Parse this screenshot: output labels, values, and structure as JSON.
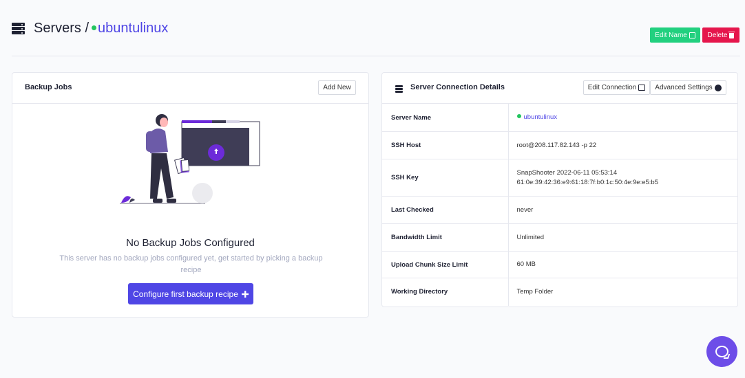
{
  "header": {
    "section": "Servers",
    "separator": "/",
    "server_name": "ubuntulinux",
    "edit_name_label": "Edit Name",
    "delete_label": "Delete"
  },
  "backup_jobs": {
    "title": "Backup Jobs",
    "add_new_label": "Add New",
    "empty_title": "No Backup Jobs Configured",
    "empty_description": "This server has no backup jobs configured yet, get started by picking a backup recipe",
    "cta_label": "Configure first backup recipe"
  },
  "connection": {
    "title": "Server Connection Details",
    "edit_connection_label": "Edit Connection",
    "advanced_settings_label": "Advanced Settings",
    "rows": [
      {
        "key": "Server Name",
        "value": "ubuntulinux"
      },
      {
        "key": "SSH Host",
        "value": "root@208.117.82.143 -p 22"
      },
      {
        "key": "SSH Key",
        "value": "SnapShooter 2022-06-11 05:53:14",
        "value2": "61:0e:39:42:36:e9:61:18:7f:b0:1c:50:4e:9e:e5:b5"
      },
      {
        "key": "Last Checked",
        "value": "never"
      },
      {
        "key": "Bandwidth Limit",
        "value": "Unlimited"
      },
      {
        "key": "Upload Chunk Size Limit",
        "value": "60 MB"
      },
      {
        "key": "Working Directory",
        "value": "Temp Folder"
      }
    ]
  },
  "colors": {
    "accent": "#4f46e5",
    "success": "#22d07f",
    "danger": "#e5164c",
    "chat": "#6d4de8"
  },
  "icons": [
    "server-icon",
    "edit-icon",
    "trash-icon",
    "plus-icon",
    "gauge-icon",
    "chat-icon"
  ]
}
